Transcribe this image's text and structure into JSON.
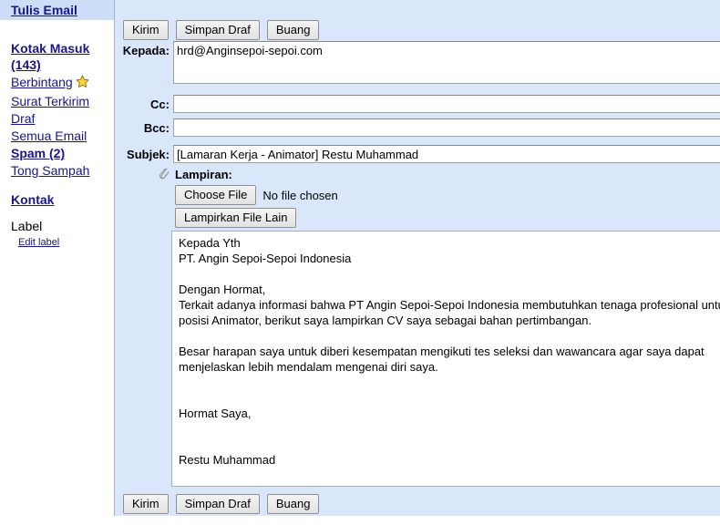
{
  "sidebar": {
    "compose_label": "Tulis Email",
    "items": [
      {
        "label": "Kotak Masuk (143)",
        "bold": true,
        "wrap": true,
        "name": "sidebar-item-inbox"
      },
      {
        "label": "Berbintang",
        "bold": false,
        "wrap": false,
        "name": "sidebar-item-starred",
        "icon": "star-icon"
      },
      {
        "label": "Surat Terkirim",
        "bold": false,
        "wrap": false,
        "name": "sidebar-item-sent"
      },
      {
        "label": "Draf",
        "bold": false,
        "wrap": false,
        "name": "sidebar-item-drafts"
      },
      {
        "label": "Semua Email",
        "bold": false,
        "wrap": false,
        "name": "sidebar-item-all-mail"
      },
      {
        "label": "Spam (2)",
        "bold": true,
        "wrap": false,
        "name": "sidebar-item-spam"
      },
      {
        "label": "Tong Sampah",
        "bold": false,
        "wrap": false,
        "name": "sidebar-item-trash"
      }
    ],
    "contacts_label": "Kontak",
    "label_section_title": "Label",
    "edit_label_link": "Edit label"
  },
  "toolbar": {
    "send_label": "Kirim",
    "save_draft_label": "Simpan Draf",
    "discard_label": "Buang"
  },
  "compose": {
    "to_label": "Kepada:",
    "to_value": "hrd@Anginsepoi-sepoi.com",
    "cc_label": "Cc:",
    "cc_value": "",
    "bcc_label": "Bcc:",
    "bcc_value": "",
    "subject_label": "Subjek:",
    "subject_value": "[Lamaran Kerja - Animator] Restu Muhammad",
    "attachment_label": "Lampiran:",
    "choose_file_label": "Choose File",
    "no_file_text": "No file chosen",
    "attach_other_label": "Lampirkan File Lain",
    "body_text": "Kepada Yth\nPT. Angin Sepoi-Sepoi Indonesia\n\nDengan Hormat,\nTerkait adanya informasi bahwa PT Angin Sepoi-Sepoi Indonesia membutuhkan tenaga profesional untuk posisi Animator, berikut saya lampirkan CV saya sebagai bahan pertimbangan.\n\nBesar harapan saya untuk diberi kesempatan mengikuti tes seleksi dan wawancara agar saya dapat menjelaskan lebih mendalam mengenai diri saya.\n\n\nHormat Saya,\n\n\nRestu Muhammad"
  },
  "colors": {
    "panel_bg": "#dae7fb",
    "band_bg": "#ccddf8",
    "link": "#18158e",
    "star": "#ffd23a"
  }
}
